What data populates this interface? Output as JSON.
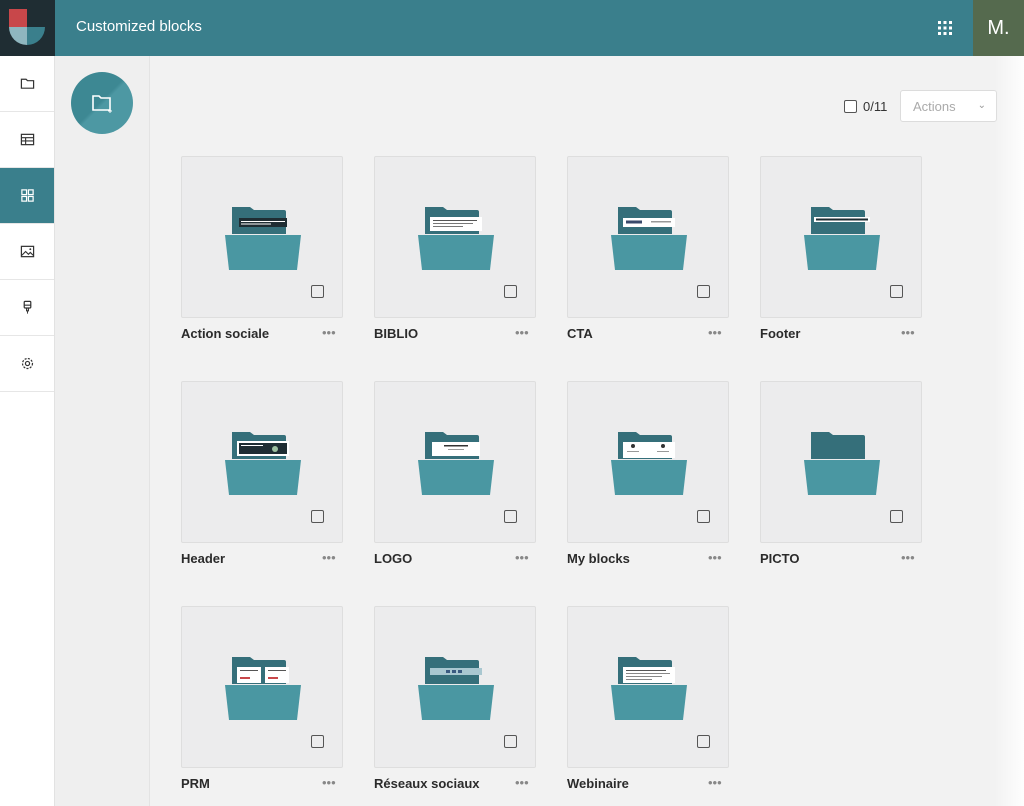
{
  "header": {
    "title": "Customized blocks",
    "avatar_initial": "M."
  },
  "sidebar": {
    "items": [
      {
        "icon": "folder-icon",
        "active": false
      },
      {
        "icon": "table-icon",
        "active": false
      },
      {
        "icon": "grid-icon",
        "active": true
      },
      {
        "icon": "image-icon",
        "active": false
      },
      {
        "icon": "paint-brush-icon",
        "active": false
      },
      {
        "icon": "gear-icon",
        "active": false
      }
    ]
  },
  "toolbar": {
    "selection_count": "0/11",
    "actions_label": "Actions"
  },
  "folders": [
    {
      "name": "Action sociale",
      "preview": "dark-banner"
    },
    {
      "name": "BIBLIO",
      "preview": "text-card"
    },
    {
      "name": "CTA",
      "preview": "button-card"
    },
    {
      "name": "Footer",
      "preview": "thin-bar"
    },
    {
      "name": "Header",
      "preview": "header-card"
    },
    {
      "name": "LOGO",
      "preview": "logo-card"
    },
    {
      "name": "My blocks",
      "preview": "two-dot-card"
    },
    {
      "name": "PICTO",
      "preview": "empty"
    },
    {
      "name": "PRM",
      "preview": "two-col-card"
    },
    {
      "name": "Réseaux sociaux",
      "preview": "social-bar"
    },
    {
      "name": "Webinaire",
      "preview": "doc-card"
    }
  ],
  "colors": {
    "brand": "#3a7f8c",
    "folder_back": "#356f7a",
    "folder_front": "#4a97a2"
  }
}
